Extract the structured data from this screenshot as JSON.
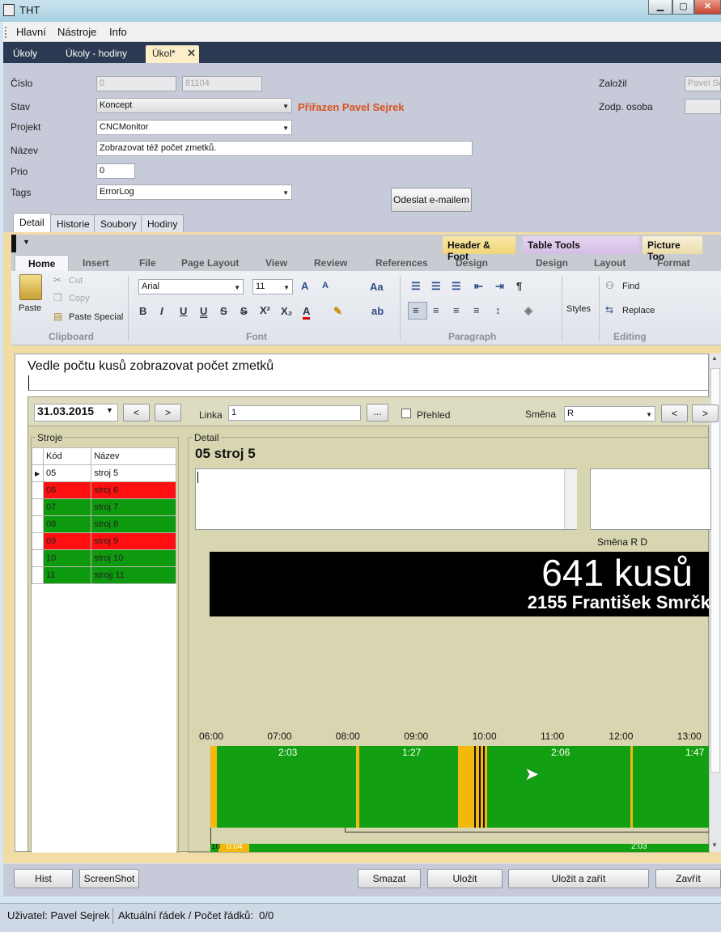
{
  "window": {
    "title": "THT",
    "min": "▁",
    "max": "▢",
    "close": "✕"
  },
  "menu": [
    "Hlavní",
    "Nástroje",
    "Info"
  ],
  "doc_tabs": [
    {
      "label": "Úkoly"
    },
    {
      "label": "Úkoly - hodiny"
    },
    {
      "label": "Úkol*"
    }
  ],
  "form": {
    "cislo_label": "Číslo",
    "cislo_value": "0",
    "cislo_value2": "81104",
    "stav_label": "Stav",
    "stav_value": "Koncept",
    "assigned_text": "Přiřazen Pavel Sejrek",
    "projekt_label": "Projekt",
    "projekt_value": "CNCMonitor",
    "nazev_label": "Název",
    "nazev_value": "Zobrazovat též počet zmetků.",
    "prio_label": "Prio",
    "prio_value": "0",
    "tags_label": "Tags",
    "tags_value": "ErrorLog",
    "email_button": "Odeslat e-mailem",
    "zalozil_label": "Založil",
    "zalozil_value": "Pavel Sej",
    "zodp_label": "Zodp. osoba",
    "zodp_value": ""
  },
  "sub_tabs": [
    "Detail",
    "Historie",
    "Soubory",
    "Hodiny"
  ],
  "ribbon": {
    "context_headers": [
      "Header & Foot",
      "Table Tools",
      "Picture Too"
    ],
    "tabs": [
      "Home",
      "Insert",
      "File",
      "Page Layout",
      "View",
      "Review",
      "References",
      "Design",
      "Design",
      "Layout",
      "Format"
    ],
    "paste": "Paste",
    "cut": "Cut",
    "copy": "Copy",
    "paste_special": "Paste Special",
    "font_name": "Arial",
    "font_size": "11",
    "styles": "Styles",
    "find": "Find",
    "replace": "Replace",
    "groups": [
      "Clipboard",
      "Font",
      "Paragraph",
      "Editing"
    ]
  },
  "editor": {
    "text": "Vedle počtu kusů zobrazovat počet zmetků"
  },
  "embedded": {
    "date": "31.03.2015",
    "prev": "<",
    "next": ">",
    "linka_label": "Linka",
    "linka_value": "1",
    "dots": "...",
    "prehled_label": "Přehled",
    "smena_label": "Směna",
    "smena_value": "R",
    "stroje_label": "Stroje",
    "col_kod": "Kód",
    "col_nazev": "Název",
    "rows": [
      {
        "kod": "05",
        "nazev": "stroj 5",
        "status": "none"
      },
      {
        "kod": "06",
        "nazev": "stroj 6",
        "status": "red"
      },
      {
        "kod": "07",
        "nazev": "stroj 7",
        "status": "green"
      },
      {
        "kod": "08",
        "nazev": "stroj 8",
        "status": "green"
      },
      {
        "kod": "09",
        "nazev": "stroj 9",
        "status": "red"
      },
      {
        "kod": "10",
        "nazev": "stroj 10",
        "status": "green"
      },
      {
        "kod": "11",
        "nazev": "strojj 11",
        "status": "green"
      }
    ],
    "detail_label": "Detail",
    "detail_title": "05 stroj 5",
    "smena_rd": "Směna R D",
    "big_count": "641 kusů",
    "big_person": "2155 František Smrčk",
    "times": [
      "06:00",
      "07:00",
      "08:00",
      "09:00",
      "10:00",
      "11:00",
      "12:00",
      "13:00"
    ],
    "durations": [
      "2:03",
      "1:27",
      "2:06",
      "1:47"
    ],
    "lower_labels": [
      "10",
      "0:04",
      "2:03"
    ]
  },
  "buttons": {
    "hist": "Hist",
    "screenshot": "ScreenShot",
    "smazat": "Smazat",
    "ulozit": "Uložit",
    "ulozit_zarit": "Uložit a zařít",
    "zavrit": "Zavřít"
  },
  "status": {
    "user": "Uživatel: Pavel Sejrek",
    "rows": "Aktuální řádek / Počet řádků:  0/0"
  },
  "colors": {
    "red": "#ff0f0f",
    "green": "#0e9a0e",
    "yellow": "#f2b80c",
    "assigned": "#d9531e"
  }
}
